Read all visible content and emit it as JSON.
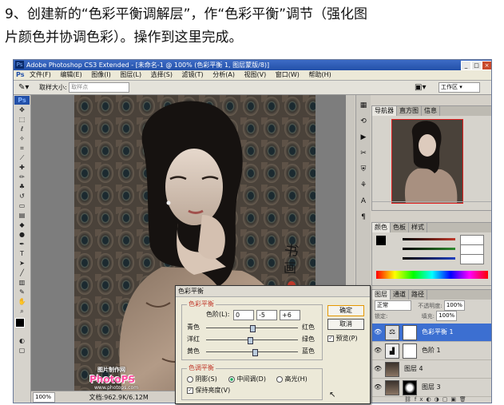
{
  "caption": {
    "line1": "9、创建新的“色彩平衡调解层”，作“色彩平衡”调节（强化图",
    "line2": "片颜色并协调色彩）。操作到这里完成。"
  },
  "app": {
    "title": "Adobe Photoshop CS3 Extended - [未命名-1 @ 100% (色彩平衡 1, 图层蒙版/8)]",
    "menus": [
      "文件(F)",
      "编辑(E)",
      "图像(I)",
      "图层(L)",
      "选择(S)",
      "滤镜(T)",
      "分析(A)",
      "视图(V)",
      "窗口(W)",
      "帮助(H)"
    ],
    "options": {
      "sample_label": "取样大小:",
      "sample_value": "取样点",
      "workspace": "工作区"
    },
    "status": {
      "zoom": "100%",
      "doc": "文档:962.9K/6.12M"
    }
  },
  "navigator": {
    "tabs": [
      "导航器",
      "直方图",
      "信息"
    ]
  },
  "color_panel": {
    "tabs": [
      "颜色",
      "色板",
      "样式"
    ],
    "colors": {
      "fg": "#000000",
      "bg": "#ffffff",
      "r": "#c0392b",
      "g": "#2e8b2e",
      "b": "#2040c0"
    }
  },
  "layers_panel": {
    "tabs": [
      "图层",
      "通道",
      "路径"
    ],
    "blend_mode": "正常",
    "opacity_label": "不透明度:",
    "opacity": "100%",
    "fill_label": "填充:",
    "fill": "100%",
    "lock_label": "锁定:",
    "layers": [
      {
        "name": "色彩平衡 1",
        "selected": true
      },
      {
        "name": "色阶 1",
        "selected": false
      },
      {
        "name": "图层 4",
        "selected": false
      },
      {
        "name": "图层 3",
        "selected": false
      }
    ]
  },
  "dialog": {
    "title": "色彩平衡",
    "balance_group": "色彩平衡",
    "levels_label": "色阶(L):",
    "levels": [
      "0",
      "-5",
      "+6"
    ],
    "sliders": [
      {
        "left": "青色",
        "right": "红色",
        "value": 0
      },
      {
        "left": "洋红",
        "right": "绿色",
        "value": -5
      },
      {
        "left": "黄色",
        "right": "蓝色",
        "value": 6
      }
    ],
    "tone_group": "色调平衡",
    "tones": [
      "阴影(S)",
      "中间调(D)",
      "高光(H)"
    ],
    "tone_selected": "中间调(D)",
    "preserve": "保持亮度(V)",
    "preserve_checked": true,
    "ok": "确定",
    "cancel": "取消",
    "preview": "预览(P)",
    "preview_checked": true
  },
  "watermark": {
    "brand": "PhotoPS",
    "cn": "图片制作网",
    "url": "www.photops.com"
  }
}
